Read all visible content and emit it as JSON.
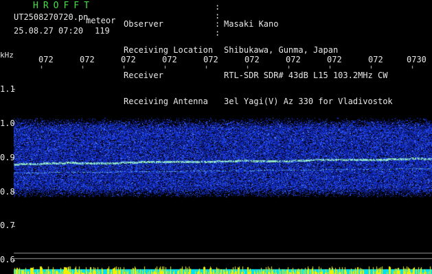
{
  "header": {
    "logo": "HROFFT",
    "file_name": "UT2508270720.pn",
    "mode": "meteor",
    "date_time": "25.08.27 07:20",
    "count": "119",
    "info": [
      {
        "label": "Observer",
        "value": "Masaki Kano"
      },
      {
        "label": "Receiving Location",
        "value": "Shibukawa, Gunma, Japan"
      },
      {
        "label": "Receiver",
        "value": "RTL-SDR SDR# 43dB L15 103.2MHz CW"
      },
      {
        "label": "Receiving Antenna",
        "value": "3el Yagi(V) Az 330 for Vladivostok"
      }
    ]
  },
  "axes": {
    "unit": "kHz",
    "time_ticks": [
      "072",
      "072",
      "072",
      "072",
      "072",
      "072",
      "072",
      "072",
      "072",
      "0730"
    ],
    "freq_ticks": [
      "1.1",
      "1.0",
      "0.9",
      "0.8",
      "0.7",
      "0.6"
    ]
  },
  "colors": {
    "background": "#000000",
    "noise_low": "#1020a0",
    "noise_high": "#4a78ff",
    "signal": "#8ef0c0",
    "meter_yellow": "#f0f000",
    "meter_cyan": "#00e0f0"
  }
}
